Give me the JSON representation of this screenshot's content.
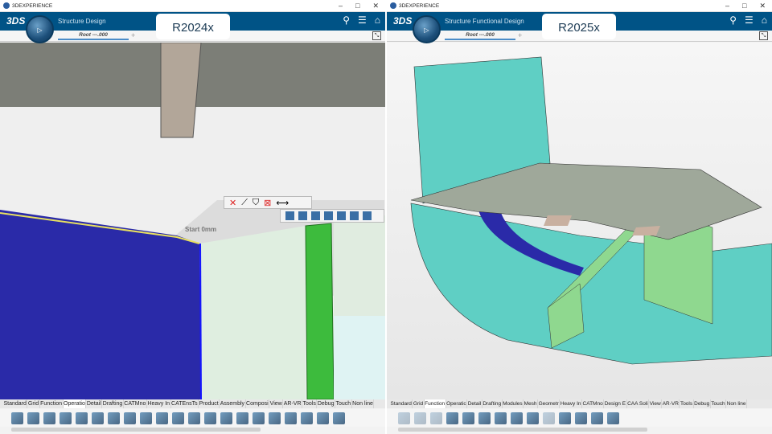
{
  "left": {
    "window_title": "3DEXPERIENCE",
    "app_name": "Structure Design",
    "version_label": "R2024x",
    "tab": "Root ---.000",
    "viewport_label": "Start 0mm",
    "workbench_tabs": [
      "Standard",
      "Grid",
      "Function",
      "Operatio",
      "Detail",
      "Drafting",
      "CATMno",
      "Heavy In",
      "CATEnsTs",
      "Product",
      "Assembly",
      "Composi",
      "View",
      "AR-VR",
      "Tools",
      "Debug",
      "Touch",
      "Non line"
    ],
    "active_tab": "Operatio"
  },
  "right": {
    "window_title": "3DEXPERIENCE",
    "app_name": "Structure Functional Design",
    "version_label": "R2025x",
    "tab": "Root ---.000",
    "workbench_tabs": [
      "Standard",
      "Grid",
      "Function",
      "Operatic",
      "Detail",
      "Drafting",
      "Modules",
      "Mesh",
      "Geometr",
      "Heavy In",
      "CATMno",
      "Design E",
      "CAA Soli",
      "View",
      "AR-VR",
      "Tools",
      "Debug",
      "Touch",
      "Non line"
    ],
    "active_tab": "Function"
  },
  "colors": {
    "brand_bar": "#005386",
    "plate_blue": "#2a2aa8",
    "stiffener_green": "#3dbb3d",
    "surface_cyan": "#5fcfc4"
  },
  "window_controls": [
    "minimize-icon",
    "maximize-icon",
    "close-icon"
  ]
}
